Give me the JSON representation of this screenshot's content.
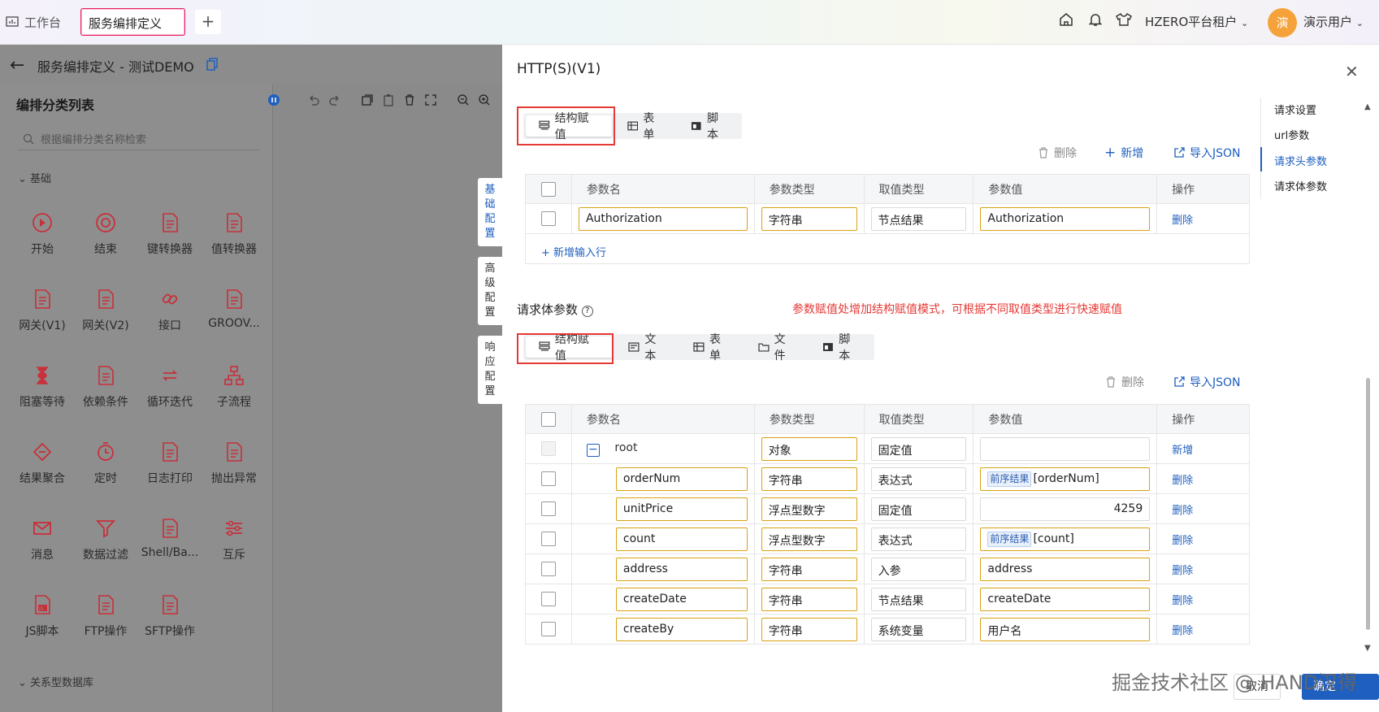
{
  "topbar": {
    "home_tab": "工作台",
    "active_tab": "服务编排定义",
    "add_tab": "+",
    "tenant": "HZERO平台租户",
    "avatar_text": "演",
    "username": "演示用户"
  },
  "editor": {
    "title": "服务编排定义 - 测试DEMO",
    "panel_title": "编排分类列表",
    "search_placeholder": "根据编排分类名称检索",
    "group_basic": "基础",
    "group_db": "关系型数据库",
    "components": [
      "开始",
      "结束",
      "键转换器",
      "值转换器",
      "网关(V1)",
      "网关(V2)",
      "接口",
      "GROOV...",
      "阻塞等待",
      "依赖条件",
      "循环迭代",
      "子流程",
      "结果聚合",
      "定时",
      "日志打印",
      "抛出异常",
      "消息",
      "数据过滤",
      "Shell/Ba...",
      "互斥",
      "JS脚本",
      "FTP操作",
      "SFTP操作"
    ],
    "vtabs": [
      "基础配置",
      "高级配置",
      "响应配置"
    ]
  },
  "drawer": {
    "title": "HTTP(S)(V1)",
    "anchors": [
      "请求设置",
      "url参数",
      "请求头参数",
      "请求体参数"
    ],
    "active_anchor": "请求头参数",
    "header_modes": [
      "结构赋值",
      "表单",
      "脚本"
    ],
    "body_modes": [
      "结构赋值",
      "文本",
      "表单",
      "文件",
      "脚本"
    ],
    "actions": {
      "delete": "删除",
      "add": "新增",
      "import": "导入JSON"
    },
    "columns": [
      "参数名",
      "参数类型",
      "取值类型",
      "参数值",
      "操作"
    ],
    "header_rows": [
      {
        "name": "Authorization",
        "type": "字符串",
        "value_type": "节点结果",
        "value": "Authorization",
        "op": "删除"
      }
    ],
    "add_row": "新增输入行",
    "body_section": "请求体参数",
    "annotation": "参数赋值处增加结构赋值模式，可根据不同取值类型进行快速赋值",
    "body_rows": [
      {
        "name": "root",
        "type": "对象",
        "value_type": "固定值",
        "tag": "",
        "value": "",
        "op": "新增"
      },
      {
        "name": "orderNum",
        "type": "字符串",
        "value_type": "表达式",
        "tag": "前序结果",
        "value": "[orderNum]",
        "op": "删除"
      },
      {
        "name": "unitPrice",
        "type": "浮点型数字",
        "value_type": "固定值",
        "tag": "",
        "value": "4259",
        "op": "删除"
      },
      {
        "name": "count",
        "type": "浮点型数字",
        "value_type": "表达式",
        "tag": "前序结果",
        "value": "[count]",
        "op": "删除"
      },
      {
        "name": "address",
        "type": "字符串",
        "value_type": "入参",
        "tag": "",
        "value": "address",
        "op": "删除"
      },
      {
        "name": "createDate",
        "type": "字符串",
        "value_type": "节点结果",
        "tag": "",
        "value": "createDate",
        "op": "删除"
      },
      {
        "name": "createBy",
        "type": "字符串",
        "value_type": "系统变量",
        "tag": "",
        "value": "用户名",
        "op": "删除"
      }
    ],
    "cancel": "取消",
    "confirm": "确定"
  },
  "watermark": "掘金技术社区 @ HAND汉得",
  "colors": {
    "accent": "#1e5fbf",
    "highlight": "#e53935",
    "field_border": "#d9a213",
    "avatar": "#f5a23a"
  }
}
